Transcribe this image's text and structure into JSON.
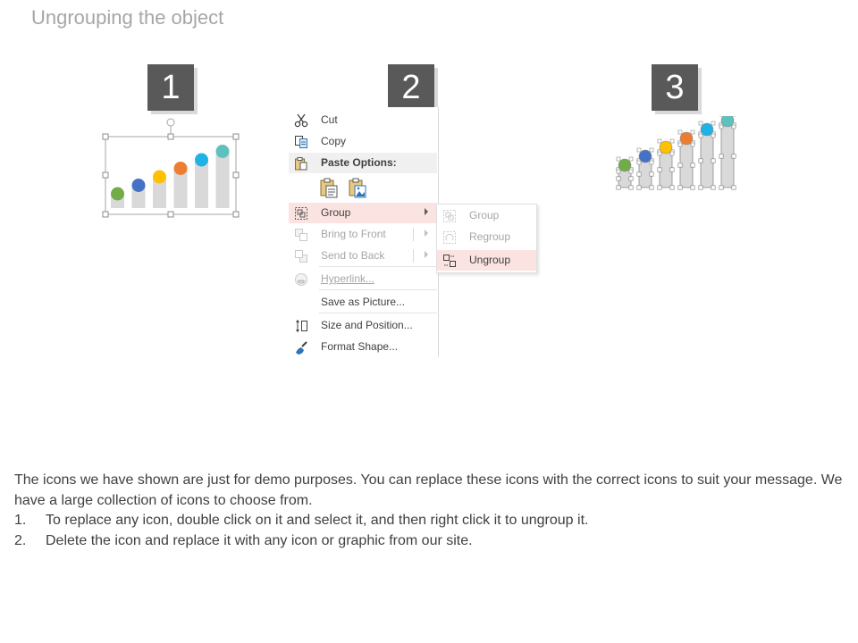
{
  "title": "Ungrouping the object",
  "steps": [
    "1",
    "2",
    "3"
  ],
  "colors": {
    "bar": "#d9d9d9",
    "dots": [
      "#70ad47",
      "#4472c4",
      "#ffc000",
      "#ed7d31",
      "#1fb2e5",
      "#5ec1be"
    ],
    "highlight": "#fbe3e1",
    "badge": "#595959"
  },
  "chart_levels": [
    1,
    2,
    3,
    4,
    5,
    6
  ],
  "context_menu": {
    "cut": "Cut",
    "copy": "Copy",
    "paste_options": "Paste Options:",
    "group": "Group",
    "bring_to_front": "Bring to Front",
    "send_to_back": "Send to Back",
    "hyperlink": "Hyperlink...",
    "save_as_picture": "Save as Picture...",
    "size_and_position": "Size and Position...",
    "format_shape": "Format Shape..."
  },
  "submenu": {
    "group": "Group",
    "regroup": "Regroup",
    "ungroup": "Ungroup"
  },
  "icons": {
    "cut": "scissors-icon",
    "copy": "copy-icon",
    "paste": "clipboard-icon",
    "group": "group-icon",
    "hyperlink": "link-icon",
    "size": "size-icon",
    "format": "format-brush-icon"
  },
  "description": {
    "intro": "The icons we have shown are just for demo purposes. You can replace these icons with the correct icons to suit your message. We have a large collection of icons to choose from.",
    "items": [
      {
        "num": "1.",
        "text": "To replace any icon, double click on it and select it, and then right click it to ungroup it."
      },
      {
        "num": "2.",
        "text": "Delete the icon and replace it with any icon or graphic from our site."
      }
    ]
  }
}
